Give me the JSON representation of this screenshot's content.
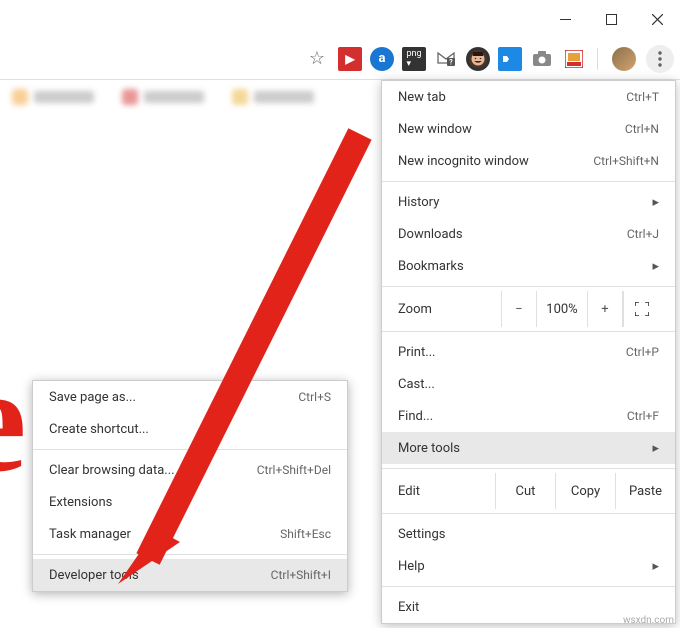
{
  "window_controls": {
    "minimize": "minimize",
    "maximize": "maximize",
    "close": "close"
  },
  "toolbar": {
    "star": "bookmark-star",
    "extensions": [
      "ext-youtube",
      "ext-allow",
      "ext-png",
      "ext-mail",
      "ext-face",
      "ext-tag",
      "ext-camera",
      "ext-imdb"
    ],
    "avatar": "profile-avatar",
    "menu": "more-menu"
  },
  "main_menu": {
    "items": [
      {
        "label": "New tab",
        "shortcut": "Ctrl+T"
      },
      {
        "label": "New window",
        "shortcut": "Ctrl+N"
      },
      {
        "label": "New incognito window",
        "shortcut": "Ctrl+Shift+N"
      }
    ],
    "history_row": {
      "label": "History",
      "caret": "▸"
    },
    "downloads_row": {
      "label": "Downloads",
      "shortcut": "Ctrl+J"
    },
    "bookmarks_row": {
      "label": "Bookmarks",
      "caret": "▸"
    },
    "zoom": {
      "label": "Zoom",
      "minus": "−",
      "value": "100%",
      "plus": "+"
    },
    "print_row": {
      "label": "Print...",
      "shortcut": "Ctrl+P"
    },
    "cast_row": {
      "label": "Cast..."
    },
    "find_row": {
      "label": "Find...",
      "shortcut": "Ctrl+F"
    },
    "more_tools_row": {
      "label": "More tools",
      "caret": "▸"
    },
    "edit": {
      "label": "Edit",
      "cut": "Cut",
      "copy": "Copy",
      "paste": "Paste"
    },
    "settings_row": {
      "label": "Settings"
    },
    "help_row": {
      "label": "Help",
      "caret": "▸"
    },
    "exit_row": {
      "label": "Exit"
    }
  },
  "sub_menu": {
    "items": [
      {
        "label": "Save page as...",
        "shortcut": "Ctrl+S"
      },
      {
        "label": "Create shortcut...",
        "shortcut": ""
      },
      {
        "label": "Clear browsing data...",
        "shortcut": "Ctrl+Shift+Del"
      },
      {
        "label": "Extensions",
        "shortcut": ""
      },
      {
        "label": "Task manager",
        "shortcut": "Shift+Esc"
      },
      {
        "label": "Developer tools",
        "shortcut": "Ctrl+Shift+I"
      }
    ]
  },
  "watermark": "wsxdn.com"
}
